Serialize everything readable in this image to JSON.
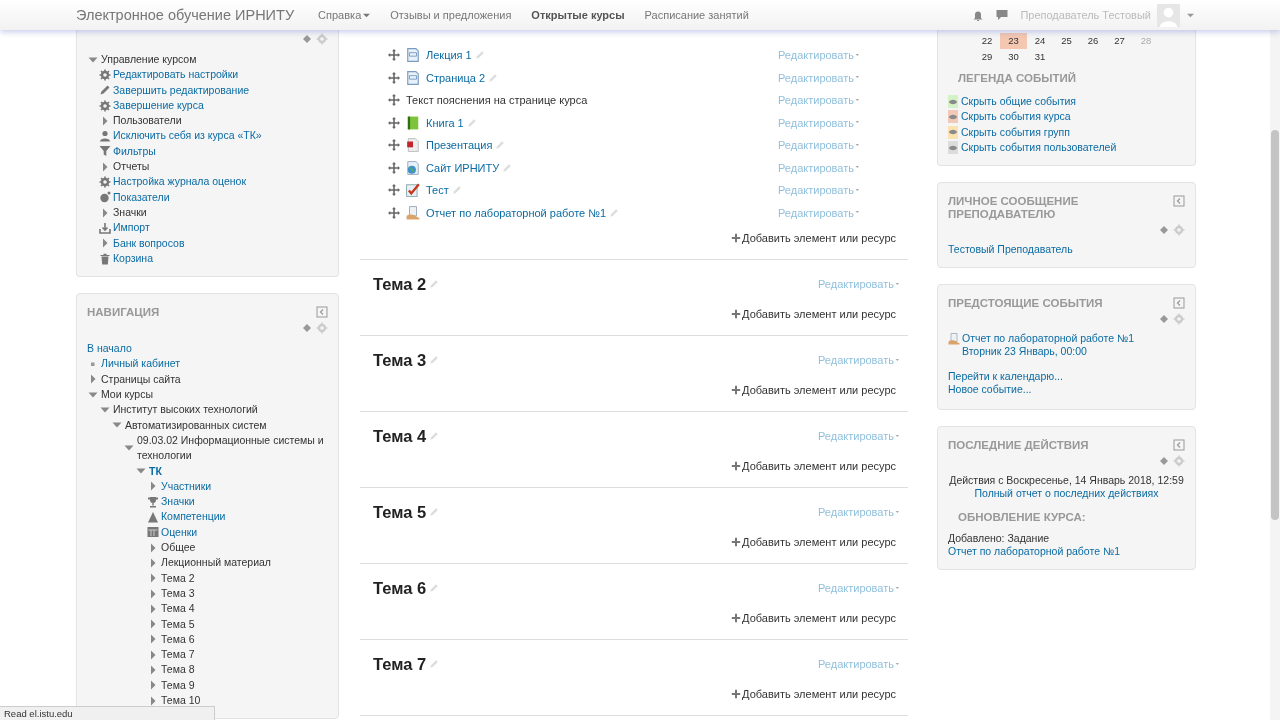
{
  "navbar": {
    "brand": "Электронное обучение ИРНИТУ",
    "menu": [
      {
        "label": "Справка",
        "dropdown": true,
        "selected": false
      },
      {
        "label": "Отзывы и предложения",
        "dropdown": false,
        "selected": false
      },
      {
        "label": "Открытые курсы",
        "dropdown": false,
        "selected": true
      },
      {
        "label": "Расписание занятий",
        "dropdown": false,
        "selected": false
      }
    ],
    "user": "Преподаватель Тестовый"
  },
  "admin": {
    "items": [
      {
        "label": "Управление курсом",
        "kind": "branch",
        "link": false,
        "expanded": true,
        "children": [
          {
            "label": "Редактировать настройки",
            "kind": "settings",
            "link": true
          },
          {
            "label": "Завершить редактирование",
            "kind": "edit",
            "link": true
          },
          {
            "label": "Завершение курса",
            "kind": "settings",
            "link": true
          },
          {
            "label": "Пользователи",
            "kind": "branch",
            "link": false,
            "expanded": false
          },
          {
            "label": "Исключить себя из курса «ТК»",
            "kind": "user",
            "link": true
          },
          {
            "label": "Фильтры",
            "kind": "filter",
            "link": true
          },
          {
            "label": "Отчеты",
            "kind": "branch",
            "link": false,
            "expanded": false
          },
          {
            "label": "Настройка журнала оценок",
            "kind": "settings",
            "link": true
          },
          {
            "label": "Показатели",
            "kind": "chart",
            "link": true
          },
          {
            "label": "Значки",
            "kind": "branch",
            "link": false,
            "expanded": false
          },
          {
            "label": "Импорт",
            "kind": "import",
            "link": true
          },
          {
            "label": "Банк вопросов",
            "kind": "branch",
            "link": true,
            "expanded": false
          },
          {
            "label": "Корзина",
            "kind": "trash",
            "link": true
          }
        ]
      }
    ]
  },
  "navigation": {
    "title": "НАВИГАЦИЯ",
    "items": [
      {
        "label": "В начало",
        "kind": "root",
        "link": true,
        "children": [
          {
            "label": "Личный кабинет",
            "kind": "leaf",
            "link": true
          },
          {
            "label": "Страницы сайта",
            "kind": "branch",
            "link": false,
            "expanded": false
          },
          {
            "label": "Мои курсы",
            "kind": "branch",
            "link": false,
            "expanded": true,
            "children": [
              {
                "label": "Институт высоких технологий",
                "kind": "branch",
                "link": false,
                "expanded": true,
                "children": [
                  {
                    "label": "Автоматизированных систем",
                    "kind": "branch",
                    "link": false,
                    "expanded": true,
                    "children": [
                      {
                        "label": "09.03.02 Информационные системы и технологии",
                        "kind": "branch",
                        "link": false,
                        "expanded": true,
                        "children": [
                          {
                            "label": "ТК",
                            "kind": "course",
                            "link": true,
                            "expanded": true,
                            "children": [
                              {
                                "label": "Участники",
                                "kind": "branch",
                                "link": true,
                                "expanded": false
                              },
                              {
                                "label": "Значки",
                                "kind": "trophy",
                                "link": true
                              },
                              {
                                "label": "Компетенции",
                                "kind": "competency",
                                "link": true
                              },
                              {
                                "label": "Оценки",
                                "kind": "grades",
                                "link": true
                              },
                              {
                                "label": "Общее",
                                "kind": "branch",
                                "link": false,
                                "expanded": false
                              },
                              {
                                "label": "Лекционный материал",
                                "kind": "branch",
                                "link": false,
                                "expanded": false
                              },
                              {
                                "label": "Тема 2",
                                "kind": "branch",
                                "link": false,
                                "expanded": false
                              },
                              {
                                "label": "Тема 3",
                                "kind": "branch",
                                "link": false,
                                "expanded": false
                              },
                              {
                                "label": "Тема 4",
                                "kind": "branch",
                                "link": false,
                                "expanded": false
                              },
                              {
                                "label": "Тема 5",
                                "kind": "branch",
                                "link": false,
                                "expanded": false
                              },
                              {
                                "label": "Тема 6",
                                "kind": "branch",
                                "link": false,
                                "expanded": false
                              },
                              {
                                "label": "Тема 7",
                                "kind": "branch",
                                "link": false,
                                "expanded": false
                              },
                              {
                                "label": "Тема 8",
                                "kind": "branch",
                                "link": false,
                                "expanded": false
                              },
                              {
                                "label": "Тема 9",
                                "kind": "branch",
                                "link": false,
                                "expanded": false
                              },
                              {
                                "label": "Тема 10",
                                "kind": "branch",
                                "link": false,
                                "expanded": false
                              }
                            ]
                          }
                        ]
                      }
                    ]
                  }
                ]
              }
            ]
          }
        ]
      }
    ]
  },
  "course": {
    "items": [
      {
        "kind": "page",
        "label": "Лекция 1",
        "edit": "Редактировать"
      },
      {
        "kind": "page",
        "label": "Страница 2",
        "edit": "Редактировать"
      },
      {
        "kind": "label",
        "label": "Текст пояснения на странице курса",
        "edit": "Редактировать"
      },
      {
        "kind": "book",
        "label": "Книга 1",
        "edit": "Редактировать"
      },
      {
        "kind": "pdf",
        "label": "Презентация",
        "edit": "Редактировать"
      },
      {
        "kind": "url",
        "label": "Сайт ИРНИТУ",
        "edit": "Редактировать"
      },
      {
        "kind": "quiz",
        "label": "Тест",
        "edit": "Редактировать"
      },
      {
        "kind": "assign",
        "label": "Отчет по лабораторной работе №1",
        "edit": "Редактировать"
      }
    ],
    "add": "Добавить элемент или ресурс",
    "sections": [
      {
        "title": "Тема 2",
        "edit": "Редактировать",
        "add": "Добавить элемент или ресурс"
      },
      {
        "title": "Тема 3",
        "edit": "Редактировать",
        "add": "Добавить элемент или ресурс"
      },
      {
        "title": "Тема 4",
        "edit": "Редактировать",
        "add": "Добавить элемент или ресурс"
      },
      {
        "title": "Тема 5",
        "edit": "Редактировать",
        "add": "Добавить элемент или ресурс"
      },
      {
        "title": "Тема 6",
        "edit": "Редактировать",
        "add": "Добавить элемент или ресурс"
      },
      {
        "title": "Тема 7",
        "edit": "Редактировать",
        "add": "Добавить элемент или ресурс"
      }
    ]
  },
  "calendar": {
    "weeks": [
      [
        {
          "day": "22",
          "today": false,
          "dimmed": false
        },
        {
          "day": "23",
          "today": true,
          "dimmed": false
        },
        {
          "day": "24",
          "today": false,
          "dimmed": false
        },
        {
          "day": "25",
          "today": false,
          "dimmed": false
        },
        {
          "day": "26",
          "today": false,
          "dimmed": false
        },
        {
          "day": "27",
          "today": false,
          "dimmed": false
        },
        {
          "day": "28",
          "today": false,
          "dimmed": true
        }
      ],
      [
        {
          "day": "29",
          "today": false,
          "dimmed": false
        },
        {
          "day": "30",
          "today": false,
          "dimmed": false
        },
        {
          "day": "31",
          "today": false,
          "dimmed": false
        }
      ]
    ],
    "legend_title": "ЛЕГЕНДА СОБЫТИЙ",
    "legend": [
      {
        "label": "Скрыть общие события",
        "color": "#d3f2c6"
      },
      {
        "label": "Скрыть события курса",
        "color": "#f2c8b8"
      },
      {
        "label": "Скрыть события групп",
        "color": "#fbe2b0"
      },
      {
        "label": "Скрыть события пользователей",
        "color": "#dcdcdc"
      }
    ]
  },
  "message": {
    "title": "ЛИЧНОЕ СООБЩЕНИЕ ПРЕПОДАВАТЕЛЮ",
    "link": "Тестовый Преподаватель"
  },
  "upcoming": {
    "title": "ПРЕДСТОЯЩИЕ СОБЫТИЯ",
    "events": [
      {
        "name": "Отчет по лабораторной работе №1",
        "date": "Вторник 23 Январь, 00:00"
      }
    ],
    "links": [
      "Перейти к календарю...",
      "Новое событие..."
    ]
  },
  "recent": {
    "title": "ПОСЛЕДНИЕ ДЕЙСТВИЯ",
    "since": "Действия с Воскресенье, 14 Январь 2018, 12:59",
    "report_link": "Полный отчет о последних действиях",
    "subtitle": "ОБНОВЛЕНИЕ КУРСА:",
    "added": "Добавлено: Задание",
    "added_link": "Отчет по лабораторной работе №1"
  },
  "status_bar": "Read el.istu.edu"
}
